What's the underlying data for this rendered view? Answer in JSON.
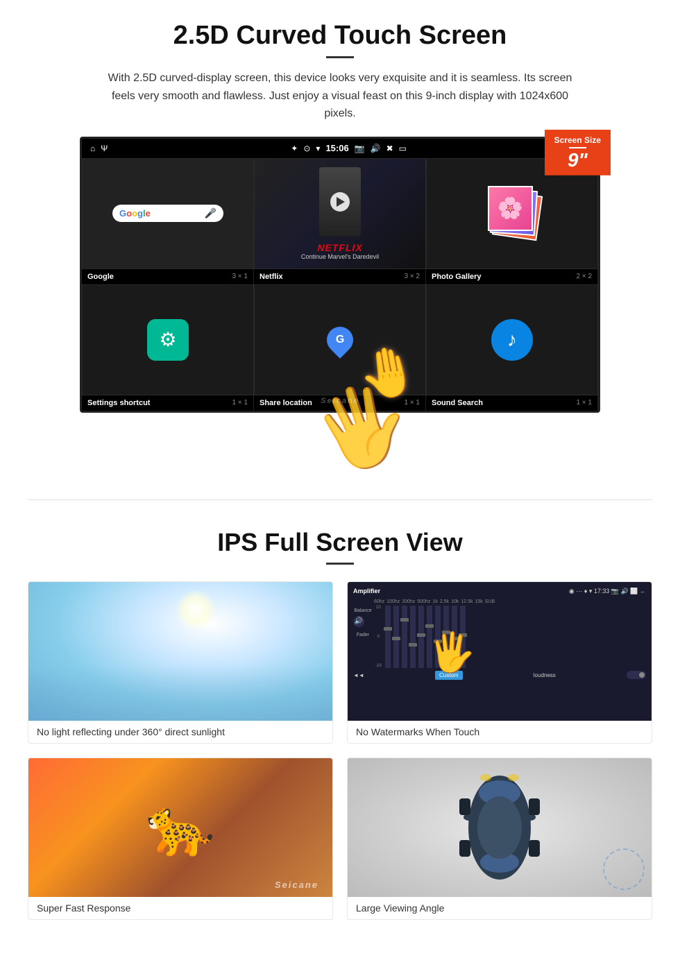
{
  "section1": {
    "title": "2.5D Curved Touch Screen",
    "description": "With 2.5D curved-display screen, this device looks very exquisite and it is seamless. Its screen feels very smooth and flawless. Just enjoy a visual feast on this 9-inch display with 1024x600 pixels.",
    "screen_badge": {
      "label": "Screen Size",
      "size": "9\""
    },
    "status_bar": {
      "time": "15:06",
      "icons": [
        "bluetooth",
        "location",
        "wifi",
        "camera",
        "volume",
        "close",
        "window"
      ]
    },
    "apps": [
      {
        "name": "Google",
        "grid": "3 × 1"
      },
      {
        "name": "Netflix",
        "grid": "3 × 2"
      },
      {
        "name": "Photo Gallery",
        "grid": "2 × 2"
      },
      {
        "name": "Settings shortcut",
        "grid": "1 × 1"
      },
      {
        "name": "Share location",
        "grid": "1 × 1"
      },
      {
        "name": "Sound Search",
        "grid": "1 × 1"
      }
    ],
    "netflix_text": "NETFLIX",
    "netflix_subtitle": "Continue Marvel's Daredevil",
    "watermark": "Seicane"
  },
  "section2": {
    "title": "IPS Full Screen View",
    "features": [
      {
        "id": "sunlight",
        "label": "No light reflecting under 360° direct sunlight"
      },
      {
        "id": "amplifier",
        "label": "No Watermarks When Touch",
        "amp_title": "Amplifier",
        "amp_bands": [
          "60hz",
          "100hz",
          "200hz",
          "500hz",
          "1k",
          "2.5k",
          "10k",
          "12.5k",
          "15k",
          "SUB"
        ],
        "amp_params": [
          "Balance",
          "Fader"
        ],
        "amp_custom": "Custom",
        "amp_loudness": "loudness"
      },
      {
        "id": "cheetah",
        "label": "Super Fast Response",
        "watermark": "Seicane"
      },
      {
        "id": "car",
        "label": "Large Viewing Angle"
      }
    ]
  }
}
